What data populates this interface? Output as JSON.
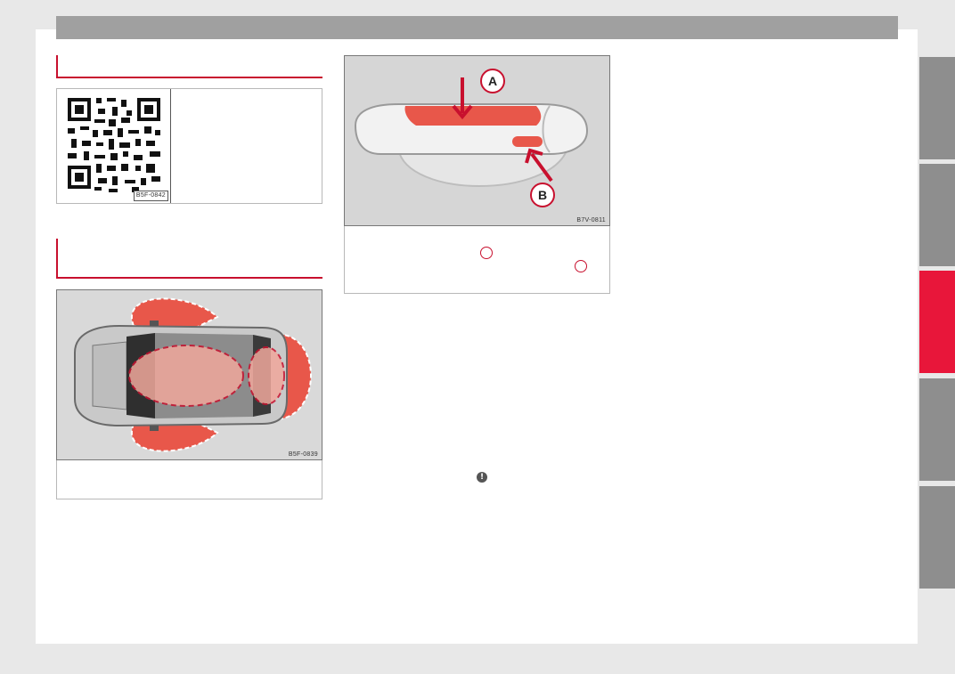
{
  "qr_figure": {
    "code": "B5F-0842"
  },
  "car_figure": {
    "code": "B5F-0839"
  },
  "handle_figure": {
    "code": "B7V-0811",
    "label_a": "A",
    "label_b": "B"
  },
  "warning": {
    "icon": "warning-icon",
    "glyph": "!"
  },
  "side_tabs": [
    {
      "state": "inactive"
    },
    {
      "state": "inactive"
    },
    {
      "state": "active"
    },
    {
      "state": "inactive"
    },
    {
      "state": "inactive"
    }
  ],
  "colors": {
    "accent": "#c8102e",
    "tab_active": "#e8163a",
    "tab_inactive": "#8e8e8e",
    "zone": "#e8574a"
  }
}
